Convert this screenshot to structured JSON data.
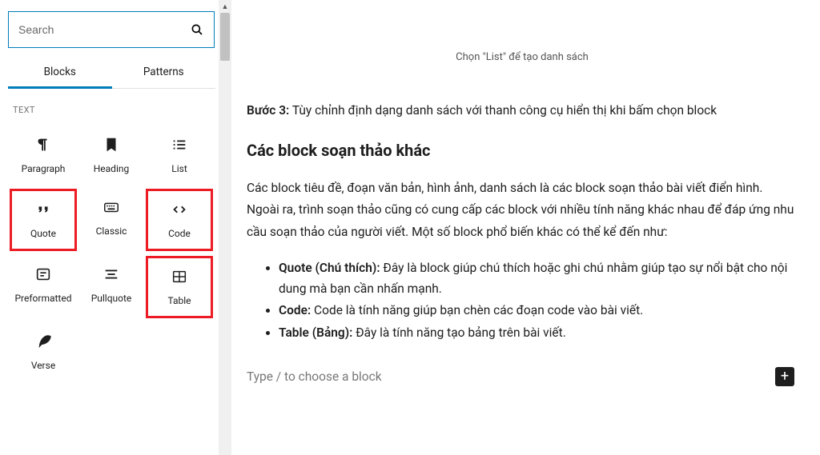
{
  "sidebar": {
    "search_placeholder": "Search",
    "tabs": {
      "blocks": "Blocks",
      "patterns": "Patterns"
    },
    "section_label": "TEXT",
    "blocks": {
      "paragraph": "Paragraph",
      "heading": "Heading",
      "list": "List",
      "quote": "Quote",
      "classic": "Classic",
      "code": "Code",
      "preformatted": "Preformatted",
      "pullquote": "Pullquote",
      "table": "Table",
      "verse": "Verse"
    }
  },
  "content": {
    "caption": "Chọn \"List\" để tạo danh sách",
    "step3_label": "Bước 3:",
    "step3_text": " Tùy chỉnh định dạng danh sách với thanh công cụ hiển thị khi bấm chọn block",
    "heading": "Các block soạn thảo khác",
    "paragraph": "Các block tiêu đề, đoạn văn bản, hình ảnh, danh sách là các block soạn thảo bài viết điển hình. Ngoài ra, trình soạn thảo cũng có cung cấp các block với nhiều tính năng khác nhau để đáp ứng nhu cầu soạn thảo của người viết. Một số block phổ biến khác có thể kể đến như:",
    "items": [
      {
        "label": "Quote (Chú thích):",
        "text": " Đây là block giúp chú thích hoặc ghi chú nhằm giúp tạo sự nổi bật cho nội dung mà bạn cần nhấn mạnh."
      },
      {
        "label": "Code:",
        "text": " Code là tính năng giúp bạn chèn các đoạn code vào bài viết."
      },
      {
        "label": "Table (Bảng):",
        "text": " Đây là tính năng tạo bảng trên bài viết."
      }
    ],
    "placeholder": "Type / to choose a block"
  }
}
